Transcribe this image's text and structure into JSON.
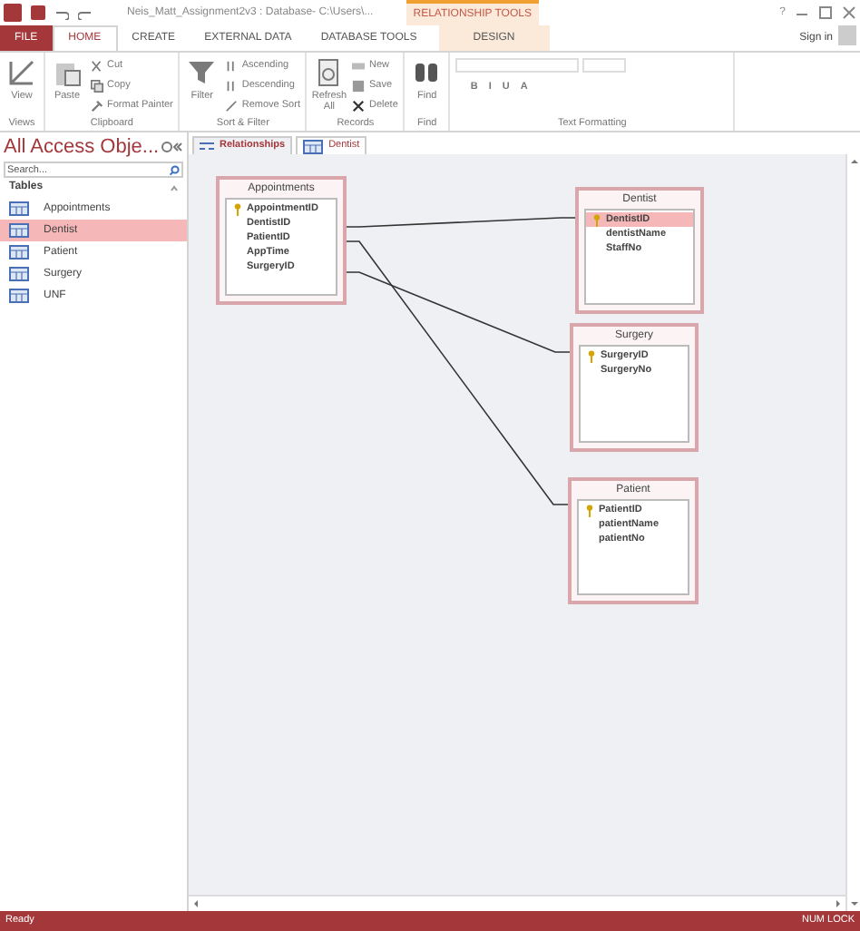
{
  "window": {
    "title": "Neis_Matt_Assignment2v3 : Database- C:\\Users\\...",
    "context_group": "RELATIONSHIP TOOLS",
    "help": "?"
  },
  "ribbon_tabs": [
    {
      "label": "FILE",
      "kind": "file",
      "selected": false
    },
    {
      "label": "HOME",
      "kind": "tab",
      "selected": true
    },
    {
      "label": "CREATE",
      "kind": "tab",
      "selected": false
    },
    {
      "label": "EXTERNAL DATA",
      "kind": "tab",
      "selected": false
    },
    {
      "label": "DATABASE TOOLS",
      "kind": "tab",
      "selected": false
    },
    {
      "label": "DESIGN",
      "kind": "contextual",
      "selected": false
    }
  ],
  "sign_in": "Sign in",
  "ribbon_groups": [
    {
      "label": "Views",
      "items": [
        {
          "label": "View",
          "kind": "large"
        }
      ]
    },
    {
      "label": "Clipboard",
      "items": [
        {
          "label": "Paste",
          "kind": "large"
        },
        {
          "label": "Cut",
          "kind": "small"
        },
        {
          "label": "Copy",
          "kind": "small"
        },
        {
          "label": "Format Painter",
          "kind": "small"
        }
      ]
    },
    {
      "label": "Sort & Filter",
      "items": [
        {
          "label": "Filter",
          "kind": "large"
        },
        {
          "label": "Ascending",
          "kind": "small"
        },
        {
          "label": "Descending",
          "kind": "small"
        },
        {
          "label": "Remove Sort",
          "kind": "small"
        }
      ]
    },
    {
      "label": "Records",
      "items": [
        {
          "label": "Refresh All",
          "kind": "large"
        },
        {
          "label": "New",
          "kind": "small"
        },
        {
          "label": "Save",
          "kind": "small"
        },
        {
          "label": "Delete",
          "kind": "small"
        }
      ]
    },
    {
      "label": "Find",
      "items": [
        {
          "label": "Find",
          "kind": "large"
        }
      ]
    },
    {
      "label": "Text Formatting",
      "items": [
        {
          "label": "B",
          "kind": "format"
        },
        {
          "label": "I",
          "kind": "format"
        },
        {
          "label": "U",
          "kind": "format"
        },
        {
          "label": "A",
          "kind": "format"
        }
      ]
    }
  ],
  "nav": {
    "title": "All Access Obje...",
    "search": {
      "placeholder": "Search..."
    },
    "section": "Tables",
    "items": [
      {
        "label": "Appointments",
        "selected": false
      },
      {
        "label": "Dentist",
        "selected": true
      },
      {
        "label": "Patient",
        "selected": false
      },
      {
        "label": "Surgery",
        "selected": false
      },
      {
        "label": "UNF",
        "selected": false
      }
    ]
  },
  "doc_tabs": [
    {
      "label": "Relationships",
      "kind": "relationships",
      "selected": true
    },
    {
      "label": "Dentist",
      "kind": "table",
      "selected": false
    }
  ],
  "tables": [
    {
      "name": "Appointments",
      "fields": [
        {
          "name": "AppointmentID",
          "key": true,
          "selected": false
        },
        {
          "name": "DentistID",
          "key": false,
          "selected": false
        },
        {
          "name": "PatientID",
          "key": false,
          "selected": false
        },
        {
          "name": "AppTime",
          "key": false,
          "selected": false
        },
        {
          "name": "SurgeryID",
          "key": false,
          "selected": false
        }
      ]
    },
    {
      "name": "Dentist",
      "fields": [
        {
          "name": "DentistID",
          "key": true,
          "selected": true
        },
        {
          "name": "dentistName",
          "key": false,
          "selected": false
        },
        {
          "name": "StaffNo",
          "key": false,
          "selected": false
        }
      ]
    },
    {
      "name": "Surgery",
      "fields": [
        {
          "name": "SurgeryID",
          "key": true,
          "selected": false
        },
        {
          "name": "SurgeryNo",
          "key": false,
          "selected": false
        }
      ]
    },
    {
      "name": "Patient",
      "fields": [
        {
          "name": "PatientID",
          "key": true,
          "selected": false
        },
        {
          "name": "patientName",
          "key": false,
          "selected": false
        },
        {
          "name": "patientNo",
          "key": false,
          "selected": false
        }
      ]
    }
  ],
  "status_bar": {
    "left": "Ready",
    "right": "NUM LOCK"
  }
}
